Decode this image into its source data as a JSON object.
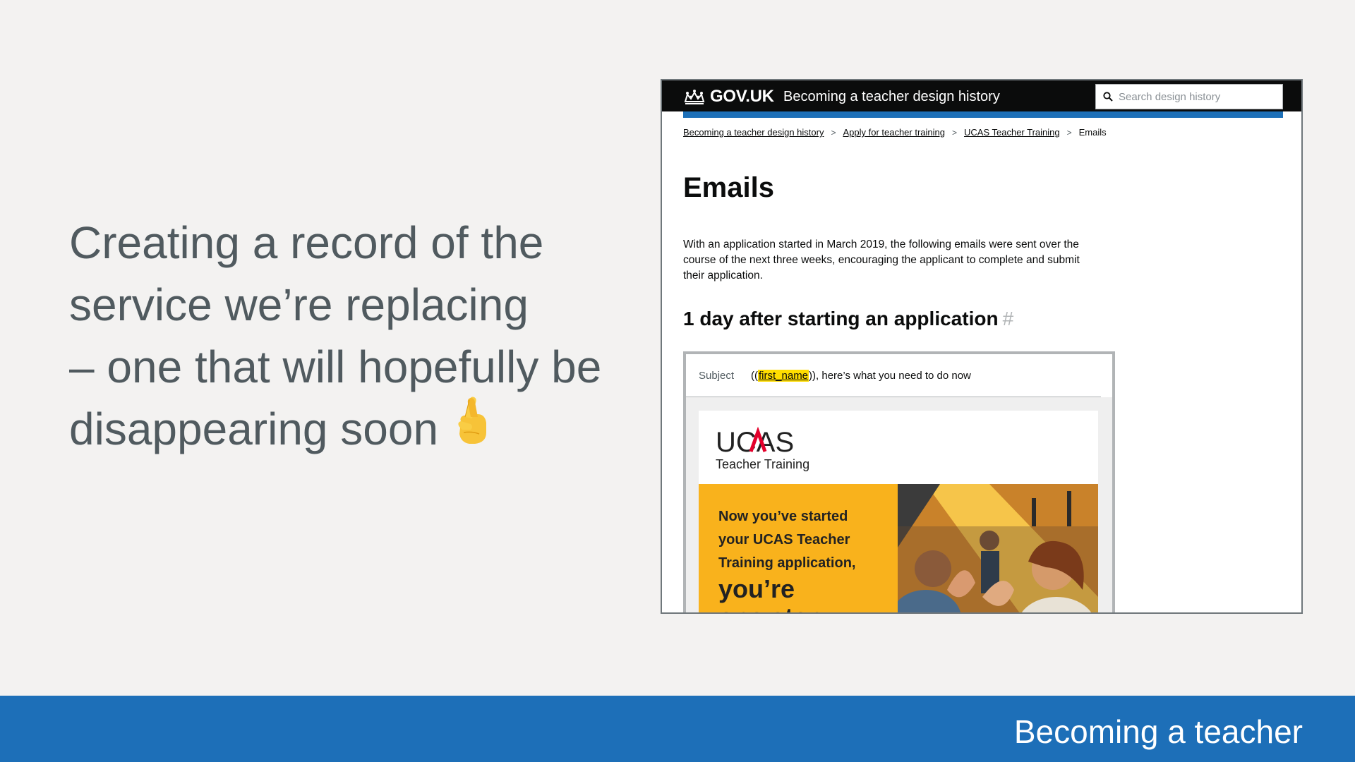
{
  "slide": {
    "statement_lines": [
      "Creating a record of the",
      "service we’re replacing",
      "– one that will hopefully be",
      "disappearing soon"
    ],
    "emoji": "crossed-fingers-emoji",
    "footer_label": "Becoming a teacher"
  },
  "screenshot": {
    "header": {
      "logo_text": "GOV.UK",
      "service_name": "Becoming a teacher design history",
      "search_placeholder": "Search design history"
    },
    "breadcrumbs": [
      "Becoming a teacher design history",
      "Apply for teacher training",
      "UCAS Teacher Training",
      "Emails"
    ],
    "page_title": "Emails",
    "intro_text": "With an application started in March 2019, the following emails were sent over the course of the next three weeks, encouraging the applicant to complete and submit their application.",
    "section_heading": "1 day after starting an application",
    "section_anchor": "#",
    "email": {
      "subject_label": "Subject",
      "subject_prefix": "((",
      "subject_placeholder": "first_name",
      "subject_suffix": ")), here’s what you need to do now",
      "brand_name": "UCAS",
      "brand_sub": "Teacher Training",
      "banner_line1": "Now you’ve started",
      "banner_line2": "your UCAS Teacher",
      "banner_line3": "Training application,",
      "banner_big": "you’re",
      "banner_cut": "one step"
    }
  },
  "colors": {
    "background": "#f3f2f1",
    "statement_text": "#505a5f",
    "gov_black": "#0b0c0c",
    "gov_blue": "#1d70b8",
    "footer_blue": "#1d6fb8",
    "highlight_yellow": "#ffdd00",
    "ucas_orange": "#f9b21c",
    "ucas_red": "#e4002b"
  }
}
